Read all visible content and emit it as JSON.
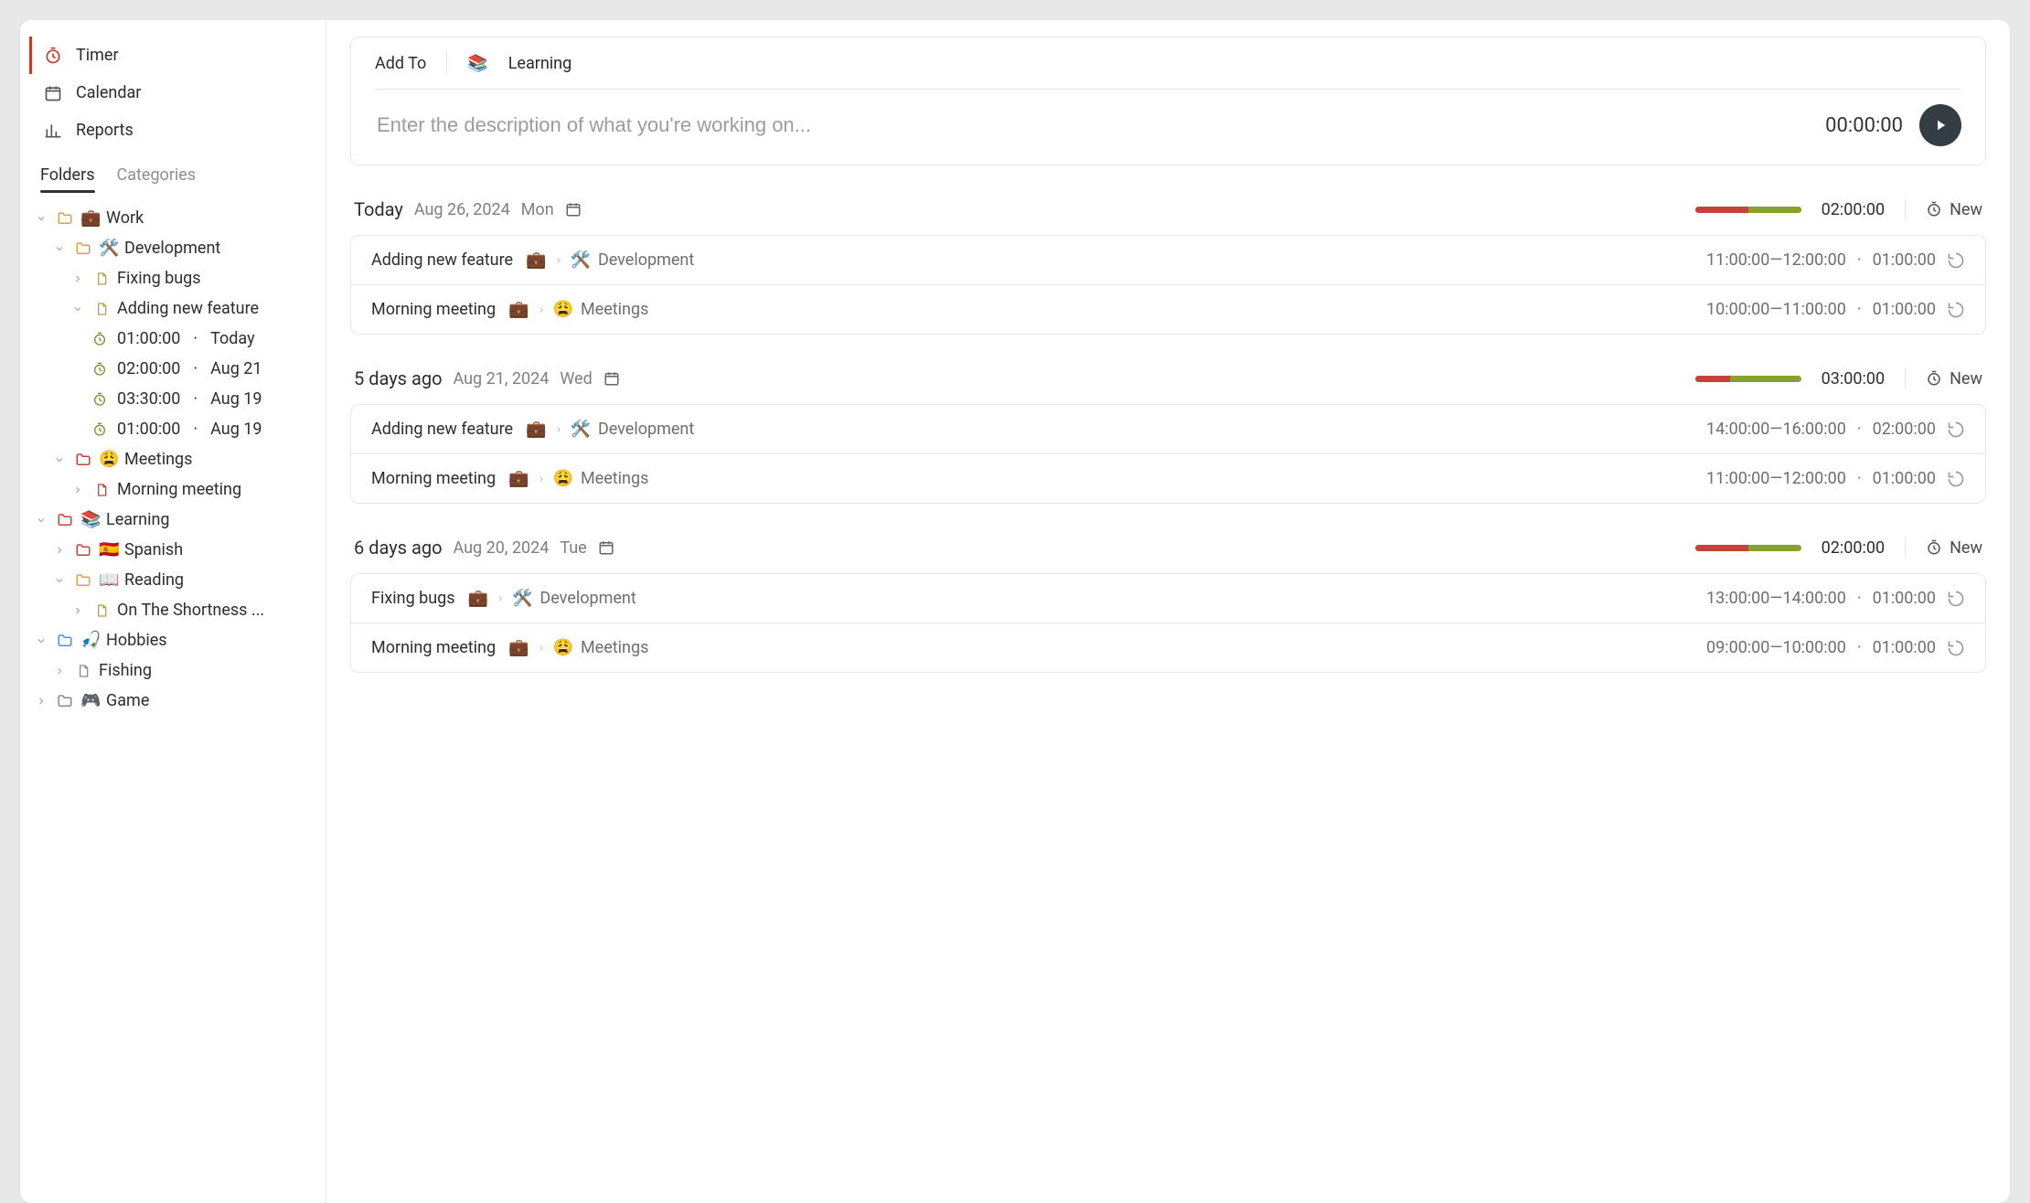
{
  "nav": {
    "timer": "Timer",
    "calendar": "Calendar",
    "reports": "Reports"
  },
  "tabs": {
    "folders": "Folders",
    "categories": "Categories"
  },
  "tree": {
    "work": {
      "label": "Work",
      "emoji": "💼"
    },
    "development": {
      "label": "Development",
      "emoji": "🛠️"
    },
    "fixing_bugs": {
      "label": "Fixing bugs"
    },
    "adding_feature": {
      "label": "Adding new feature"
    },
    "times": [
      {
        "dur": "01:00:00",
        "date": "Today"
      },
      {
        "dur": "02:00:00",
        "date": "Aug 21"
      },
      {
        "dur": "03:30:00",
        "date": "Aug 19"
      },
      {
        "dur": "01:00:00",
        "date": "Aug 19"
      }
    ],
    "meetings": {
      "label": "Meetings",
      "emoji": "😩"
    },
    "morning_meeting": {
      "label": "Morning meeting"
    },
    "learning": {
      "label": "Learning",
      "emoji": "📚"
    },
    "spanish": {
      "label": "Spanish",
      "emoji": "🇪🇸"
    },
    "reading": {
      "label": "Reading",
      "emoji": "📖"
    },
    "shortness": {
      "label": "On The Shortness ..."
    },
    "hobbies": {
      "label": "Hobbies",
      "emoji": "🎣"
    },
    "fishing": {
      "label": "Fishing"
    },
    "game": {
      "label": "Game",
      "emoji": "🎮"
    }
  },
  "compose": {
    "addto": "Add To",
    "target_emoji": "📚",
    "target_label": "Learning",
    "placeholder": "Enter the description of what you're working on...",
    "elapsed": "00:00:00"
  },
  "groups": [
    {
      "title": "Today",
      "date": "Aug 26, 2024",
      "day": "Mon",
      "bar_red": 50,
      "bar_green": 50,
      "total": "02:00:00",
      "new": "New",
      "entries": [
        {
          "name": "Adding new feature",
          "emoji": "💼",
          "cat_emoji": "🛠️",
          "cat": "Development",
          "time": "11:00:00—12:00:00",
          "dur": "01:00:00"
        },
        {
          "name": "Morning meeting",
          "emoji": "💼",
          "cat_emoji": "😩",
          "cat": "Meetings",
          "time": "10:00:00—11:00:00",
          "dur": "01:00:00"
        }
      ]
    },
    {
      "title": "5 days ago",
      "date": "Aug 21, 2024",
      "day": "Wed",
      "bar_red": 33,
      "bar_green": 67,
      "total": "03:00:00",
      "new": "New",
      "entries": [
        {
          "name": "Adding new feature",
          "emoji": "💼",
          "cat_emoji": "🛠️",
          "cat": "Development",
          "time": "14:00:00—16:00:00",
          "dur": "02:00:00"
        },
        {
          "name": "Morning meeting",
          "emoji": "💼",
          "cat_emoji": "😩",
          "cat": "Meetings",
          "time": "11:00:00—12:00:00",
          "dur": "01:00:00"
        }
      ]
    },
    {
      "title": "6 days ago",
      "date": "Aug 20, 2024",
      "day": "Tue",
      "bar_red": 50,
      "bar_green": 50,
      "total": "02:00:00",
      "new": "New",
      "entries": [
        {
          "name": "Fixing bugs",
          "emoji": "💼",
          "cat_emoji": "🛠️",
          "cat": "Development",
          "time": "13:00:00—14:00:00",
          "dur": "01:00:00"
        },
        {
          "name": "Morning meeting",
          "emoji": "💼",
          "cat_emoji": "😩",
          "cat": "Meetings",
          "time": "09:00:00—10:00:00",
          "dur": "01:00:00"
        }
      ]
    }
  ]
}
